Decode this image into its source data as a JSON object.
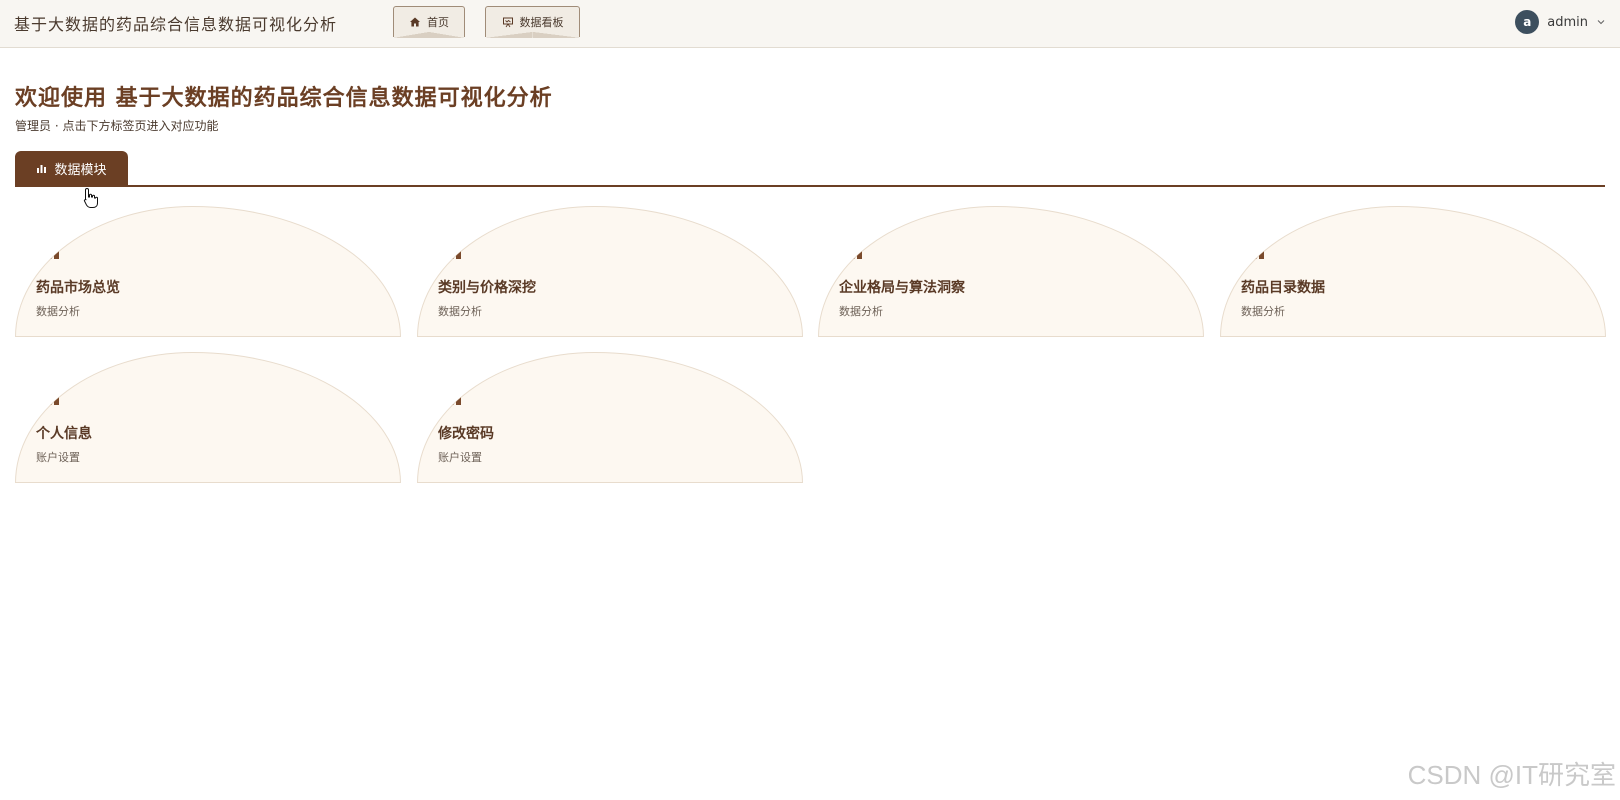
{
  "header": {
    "app_title": "基于大数据的药品综合信息数据可视化分析",
    "nav": [
      {
        "label": "首页",
        "icon": "home-icon"
      },
      {
        "label": "数据看板",
        "icon": "dashboard-icon"
      }
    ],
    "user": {
      "avatar_letter": "a",
      "name": "admin"
    }
  },
  "welcome": {
    "title": "欢迎使用 基于大数据的药品综合信息数据可视化分析",
    "subtitle": "管理员 · 点击下方标签页进入对应功能"
  },
  "tabs": [
    {
      "label": "数据模块",
      "icon": "bar-chart-icon",
      "active": true
    }
  ],
  "cards": [
    {
      "title": "药品市场总览",
      "subtitle": "数据分析",
      "icon": "bar-chart-icon"
    },
    {
      "title": "类别与价格深挖",
      "subtitle": "数据分析",
      "icon": "bar-chart-icon"
    },
    {
      "title": "企业格局与算法洞察",
      "subtitle": "数据分析",
      "icon": "bar-chart-icon"
    },
    {
      "title": "药品目录数据",
      "subtitle": "数据分析",
      "icon": "bar-chart-icon"
    },
    {
      "title": "个人信息",
      "subtitle": "账户设置",
      "icon": "bar-chart-icon"
    },
    {
      "title": "修改密码",
      "subtitle": "账户设置",
      "icon": "bar-chart-icon"
    }
  ],
  "watermark": "CSDN @IT研究室",
  "colors": {
    "accent": "#6b3f24",
    "header_bg": "#f8f6f2",
    "card_bg": "#fdf8f1",
    "card_border": "#e8dccd",
    "avatar_bg": "#3d4f5e"
  }
}
